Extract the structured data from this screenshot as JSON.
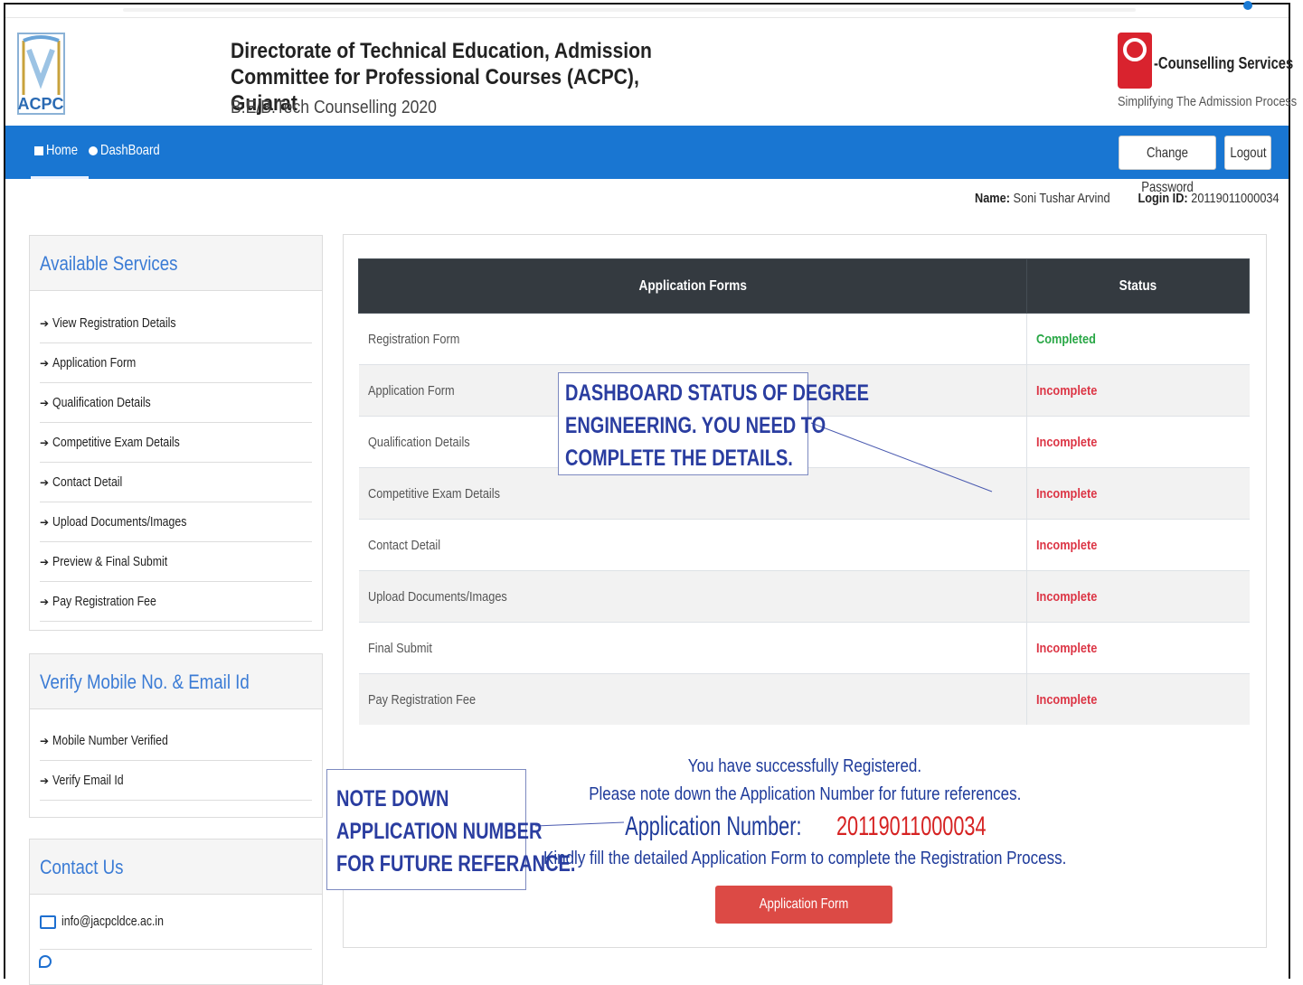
{
  "header": {
    "logo_text": "ACPC",
    "title": "Directorate of Technical Education, Admission Committee for Professional Courses (ACPC), Gujarat",
    "subtitle": "B.E/B.Tech Counselling 2020",
    "brand_name": "-Counselling Services",
    "brand_tagline": "Simplifying The Admission Process"
  },
  "nav": {
    "home": "Home",
    "dashboard": "DashBoard",
    "change_password": "Change Password",
    "logout": "Logout"
  },
  "user": {
    "name_label": "Name:",
    "name": "Soni Tushar Arvind",
    "login_label": "Login ID:",
    "login_id": "20119011000034"
  },
  "services": {
    "title": "Available Services",
    "items": [
      "View Registration Details",
      "Application Form",
      "Qualification Details",
      "Competitive Exam Details",
      "Contact Detail",
      "Upload Documents/Images",
      "Preview & Final Submit",
      "Pay Registration Fee"
    ]
  },
  "verify": {
    "title": "Verify Mobile No. & Email Id",
    "items": [
      "Mobile Number Verified",
      "Verify Email Id"
    ]
  },
  "contact": {
    "title": "Contact Us",
    "email": "info@jacpcldce.ac.in"
  },
  "table": {
    "col1": "Application Forms",
    "col2": "Status",
    "rows": [
      {
        "form": "Registration Form",
        "status": "Completed"
      },
      {
        "form": "Application Form",
        "status": "Incomplete"
      },
      {
        "form": "Qualification Details",
        "status": "Incomplete"
      },
      {
        "form": "Competitive Exam Details",
        "status": "Incomplete"
      },
      {
        "form": "Contact Detail",
        "status": "Incomplete"
      },
      {
        "form": "Upload Documents/Images",
        "status": "Incomplete"
      },
      {
        "form": "Final Submit",
        "status": "Incomplete"
      },
      {
        "form": "Pay Registration Fee",
        "status": "Incomplete"
      }
    ]
  },
  "annotations": {
    "dashboard_note": [
      "DASHBOARD STATUS OF DEGREE",
      "ENGINEERING. YOU NEED TO",
      "COMPLETE THE DETAILS."
    ],
    "app_number_note": [
      "NOTE DOWN",
      "APPLICATION NUMBER",
      "FOR FUTURE REFERANCE."
    ]
  },
  "message": {
    "line1": "You have successfully Registered.",
    "line2": "Please note down the Application Number for future references.",
    "app_number_label": "Application Number:",
    "app_number": "20119011000034",
    "line4": "Kindly fill the detailed Application Form to complete the Registration Process.",
    "button": "Application Form"
  },
  "colors": {
    "navbar": "#1976d2",
    "completed": "#28a745",
    "incomplete": "#dc3545",
    "table_header": "#343a40",
    "app_button": "#dc4a45"
  }
}
